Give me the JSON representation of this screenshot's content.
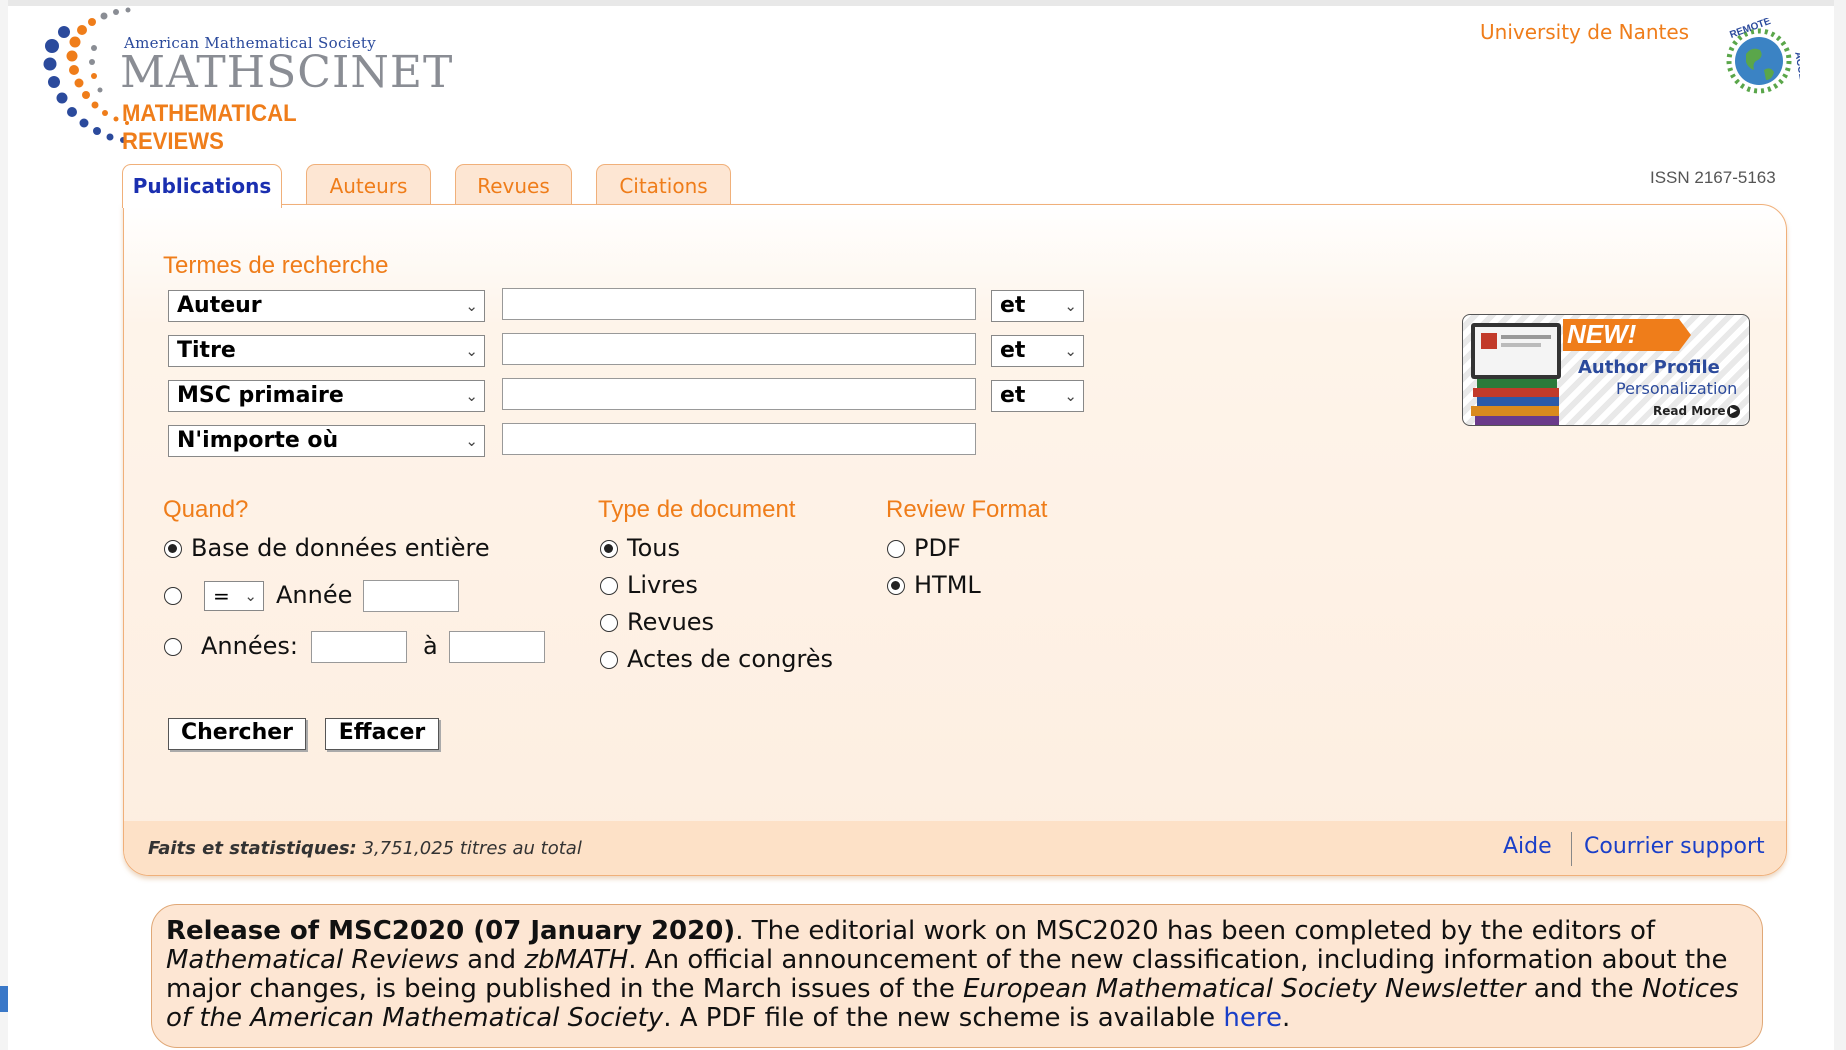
{
  "logo": {
    "society": "American Mathematical Society",
    "product": "MATHSCINET",
    "subtitle": "MATHEMATICAL REVIEWS",
    "remote_text": "REMOTE ACCESS"
  },
  "institution": "University de Nantes",
  "issn": "ISSN 2167-5163",
  "tabs": [
    {
      "label": "Publications",
      "active": true
    },
    {
      "label": "Auteurs",
      "active": false
    },
    {
      "label": "Revues",
      "active": false
    },
    {
      "label": "Citations",
      "active": false
    }
  ],
  "search": {
    "heading": "Termes de recherche",
    "rows": [
      {
        "field": "Auteur",
        "value": "",
        "operator": "et"
      },
      {
        "field": "Titre",
        "value": "",
        "operator": "et"
      },
      {
        "field": "MSC primaire",
        "value": "",
        "operator": "et"
      },
      {
        "field": "N'importe où",
        "value": ""
      }
    ]
  },
  "when": {
    "heading": "Quand?",
    "option_all": "Base de données entière",
    "compare_value": "=",
    "year_label": "Année",
    "years_label": "Années:",
    "to_label": "à",
    "selected": "all"
  },
  "doc_type": {
    "heading": "Type de document",
    "options": [
      "Tous",
      "Livres",
      "Revues",
      "Actes de congrès"
    ],
    "selected": "Tous"
  },
  "review_format": {
    "heading": "Review Format",
    "options": [
      "PDF",
      "HTML"
    ],
    "selected": "HTML"
  },
  "buttons": {
    "search": "Chercher",
    "clear": "Effacer"
  },
  "promo": {
    "badge": "NEW!",
    "line1": "Author Profile",
    "line2": "Personalization",
    "cta": "Read More"
  },
  "footer": {
    "stats_label": "Faits et statistiques:",
    "stats_value": "3,751,025 titres au total",
    "help": "Aide",
    "support": "Courrier support"
  },
  "news": {
    "title": "Release of MSC2020 (07 January 2020)",
    "t1": ". The editorial work on MSC2020 has been completed by the editors of ",
    "i1": "Mathematical Reviews",
    "t2": " and ",
    "i2": "zbMATH",
    "t3": ". An official announcement of the new classification, including information about the major changes, is being published in the March issues of the ",
    "i3": "European Mathematical Society Newsletter",
    "t4": " and the ",
    "i4": "Notices of the American Mathematical Society",
    "t5": ". A PDF file of the new scheme is available ",
    "link": "here",
    "t6": "."
  },
  "colors": {
    "accent": "#ef7d1a",
    "link": "#1a3fc8",
    "panel": "#fdeee0",
    "tab_border": "#f0b07a"
  }
}
